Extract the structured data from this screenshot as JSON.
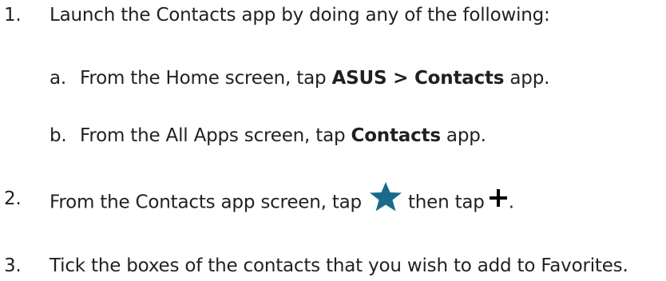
{
  "steps": [
    {
      "number": "1.",
      "text": "Launch the Contacts app by doing any of the following:"
    },
    {
      "substeps": [
        {
          "letter": "a.",
          "prefix": "From the Home screen, tap ",
          "bold1": "ASUS",
          "sep": " > ",
          "bold2": "Contacts",
          "suffix": " app."
        },
        {
          "letter": "b.",
          "prefix": "From the All Apps screen, tap ",
          "bold": "Contacts",
          "suffix": " app."
        }
      ]
    },
    {
      "number": "2.",
      "prefix": "From the Contacts app screen, tap",
      "middle": "then tap",
      "suffix": "."
    },
    {
      "number": "3.",
      "text": "Tick the boxes of the contacts that you wish to add to Favorites."
    }
  ],
  "icons": {
    "star": {
      "name": "star-icon",
      "color": "#1a6a8c"
    },
    "plus": {
      "name": "plus-icon",
      "color": "#000000"
    }
  }
}
